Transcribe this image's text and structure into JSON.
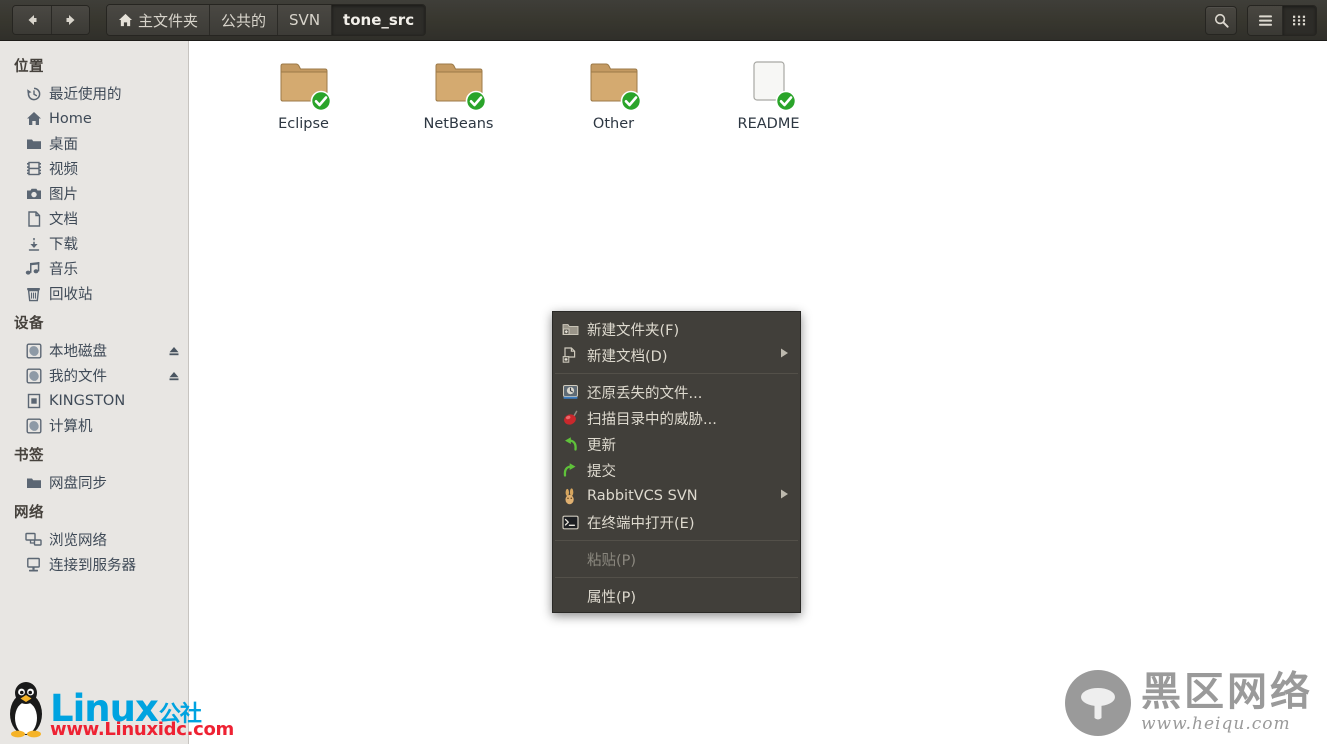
{
  "header": {
    "nav": {
      "back_label": "后退",
      "back_icon": "arrow-left-icon",
      "forward_label": "前进",
      "forward_icon": "arrow-right-icon"
    },
    "breadcrumbs": [
      {
        "label": "主文件夹",
        "icon": "home-icon",
        "active": false
      },
      {
        "label": "公共的",
        "icon": "",
        "active": false
      },
      {
        "label": "SVN",
        "icon": "",
        "active": false
      },
      {
        "label": "tone_src",
        "icon": "",
        "active": true
      }
    ],
    "actions": [
      {
        "name": "search-button",
        "label": "搜索",
        "icon": "search-icon"
      },
      {
        "name": "list-view-button",
        "label": "列表视图",
        "icon": "list-view-icon",
        "active": false
      },
      {
        "name": "grid-view-button",
        "label": "图标视图",
        "icon": "grid-view-icon",
        "active": true
      }
    ]
  },
  "sidebar": {
    "sections": [
      {
        "title": "位置",
        "items": [
          {
            "label": "最近使用的",
            "icon": "recent-icon",
            "eject": false
          },
          {
            "label": "Home",
            "icon": "home-icon",
            "eject": false
          },
          {
            "label": "桌面",
            "icon": "folder-icon",
            "eject": false
          },
          {
            "label": "视频",
            "icon": "video-icon",
            "eject": false
          },
          {
            "label": "图片",
            "icon": "camera-icon",
            "eject": false
          },
          {
            "label": "文档",
            "icon": "document-icon",
            "eject": false
          },
          {
            "label": "下载",
            "icon": "download-icon",
            "eject": false
          },
          {
            "label": "音乐",
            "icon": "music-icon",
            "eject": false
          },
          {
            "label": "回收站",
            "icon": "trash-icon",
            "eject": false
          }
        ]
      },
      {
        "title": "设备",
        "items": [
          {
            "label": "本地磁盘",
            "icon": "disk-icon",
            "eject": true
          },
          {
            "label": "我的文件",
            "icon": "disk-icon",
            "eject": true
          },
          {
            "label": "KINGSTON",
            "icon": "drive-removable-icon",
            "eject": false
          },
          {
            "label": "计算机",
            "icon": "disk-icon",
            "eject": false
          }
        ]
      },
      {
        "title": "书签",
        "items": [
          {
            "label": "网盘同步",
            "icon": "folder-icon",
            "eject": false
          }
        ]
      },
      {
        "title": "网络",
        "items": [
          {
            "label": "浏览网络",
            "icon": "network-icon",
            "eject": false
          },
          {
            "label": "连接到服务器",
            "icon": "server-icon",
            "eject": false
          }
        ]
      }
    ]
  },
  "main": {
    "files": [
      {
        "name": "Eclipse",
        "type": "folder",
        "emblem": "ok-emblem-icon"
      },
      {
        "name": "NetBeans",
        "type": "folder",
        "emblem": "ok-emblem-icon"
      },
      {
        "name": "Other",
        "type": "folder",
        "emblem": "ok-emblem-icon"
      },
      {
        "name": "README",
        "type": "document",
        "emblem": "ok-emblem-icon"
      }
    ]
  },
  "context_menu": {
    "items": [
      {
        "kind": "item",
        "label": "新建文件夹(F)",
        "icon": "new-folder-icon",
        "submenu": false,
        "disabled": false
      },
      {
        "kind": "item",
        "label": "新建文档(D)",
        "icon": "new-document-icon",
        "submenu": true,
        "disabled": false
      },
      {
        "kind": "separator"
      },
      {
        "kind": "item",
        "label": "还原丢失的文件...",
        "icon": "restore-icon",
        "submenu": false,
        "disabled": false
      },
      {
        "kind": "item",
        "label": "扫描目录中的威胁...",
        "icon": "virus-scan-icon",
        "submenu": false,
        "disabled": false
      },
      {
        "kind": "item",
        "label": "更新",
        "icon": "svn-update-icon",
        "submenu": false,
        "disabled": false
      },
      {
        "kind": "item",
        "label": "提交",
        "icon": "svn-commit-icon",
        "submenu": false,
        "disabled": false
      },
      {
        "kind": "item",
        "label": "RabbitVCS SVN",
        "icon": "rabbitvcs-icon",
        "submenu": true,
        "disabled": false
      },
      {
        "kind": "item",
        "label": "在终端中打开(E)",
        "icon": "terminal-icon",
        "submenu": false,
        "disabled": false
      },
      {
        "kind": "separator"
      },
      {
        "kind": "item",
        "label": "粘贴(P)",
        "icon": "",
        "submenu": false,
        "disabled": true
      },
      {
        "kind": "separator"
      },
      {
        "kind": "item",
        "label": "属性(P)",
        "icon": "",
        "submenu": false,
        "disabled": false
      }
    ]
  },
  "watermarks": {
    "left": {
      "brand": "Linux",
      "suffix": "公社",
      "url": "www.Linuxidc.com",
      "brand_color": "#00a3e0",
      "url_color": "#ee2233"
    },
    "right": {
      "brand": "黑区网络",
      "url": "www.heiqu.com",
      "color": "#9a9a9a",
      "icon": "mushroom-icon"
    }
  },
  "colors": {
    "headerbar": "#38372f",
    "sidebar_bg": "#e8e6e3",
    "main_bg": "#ffffff",
    "menu_bg": "#413f3a",
    "menu_text": "#dedacf",
    "menu_disabled": "#8b887f",
    "folder": "#c9a96a"
  }
}
